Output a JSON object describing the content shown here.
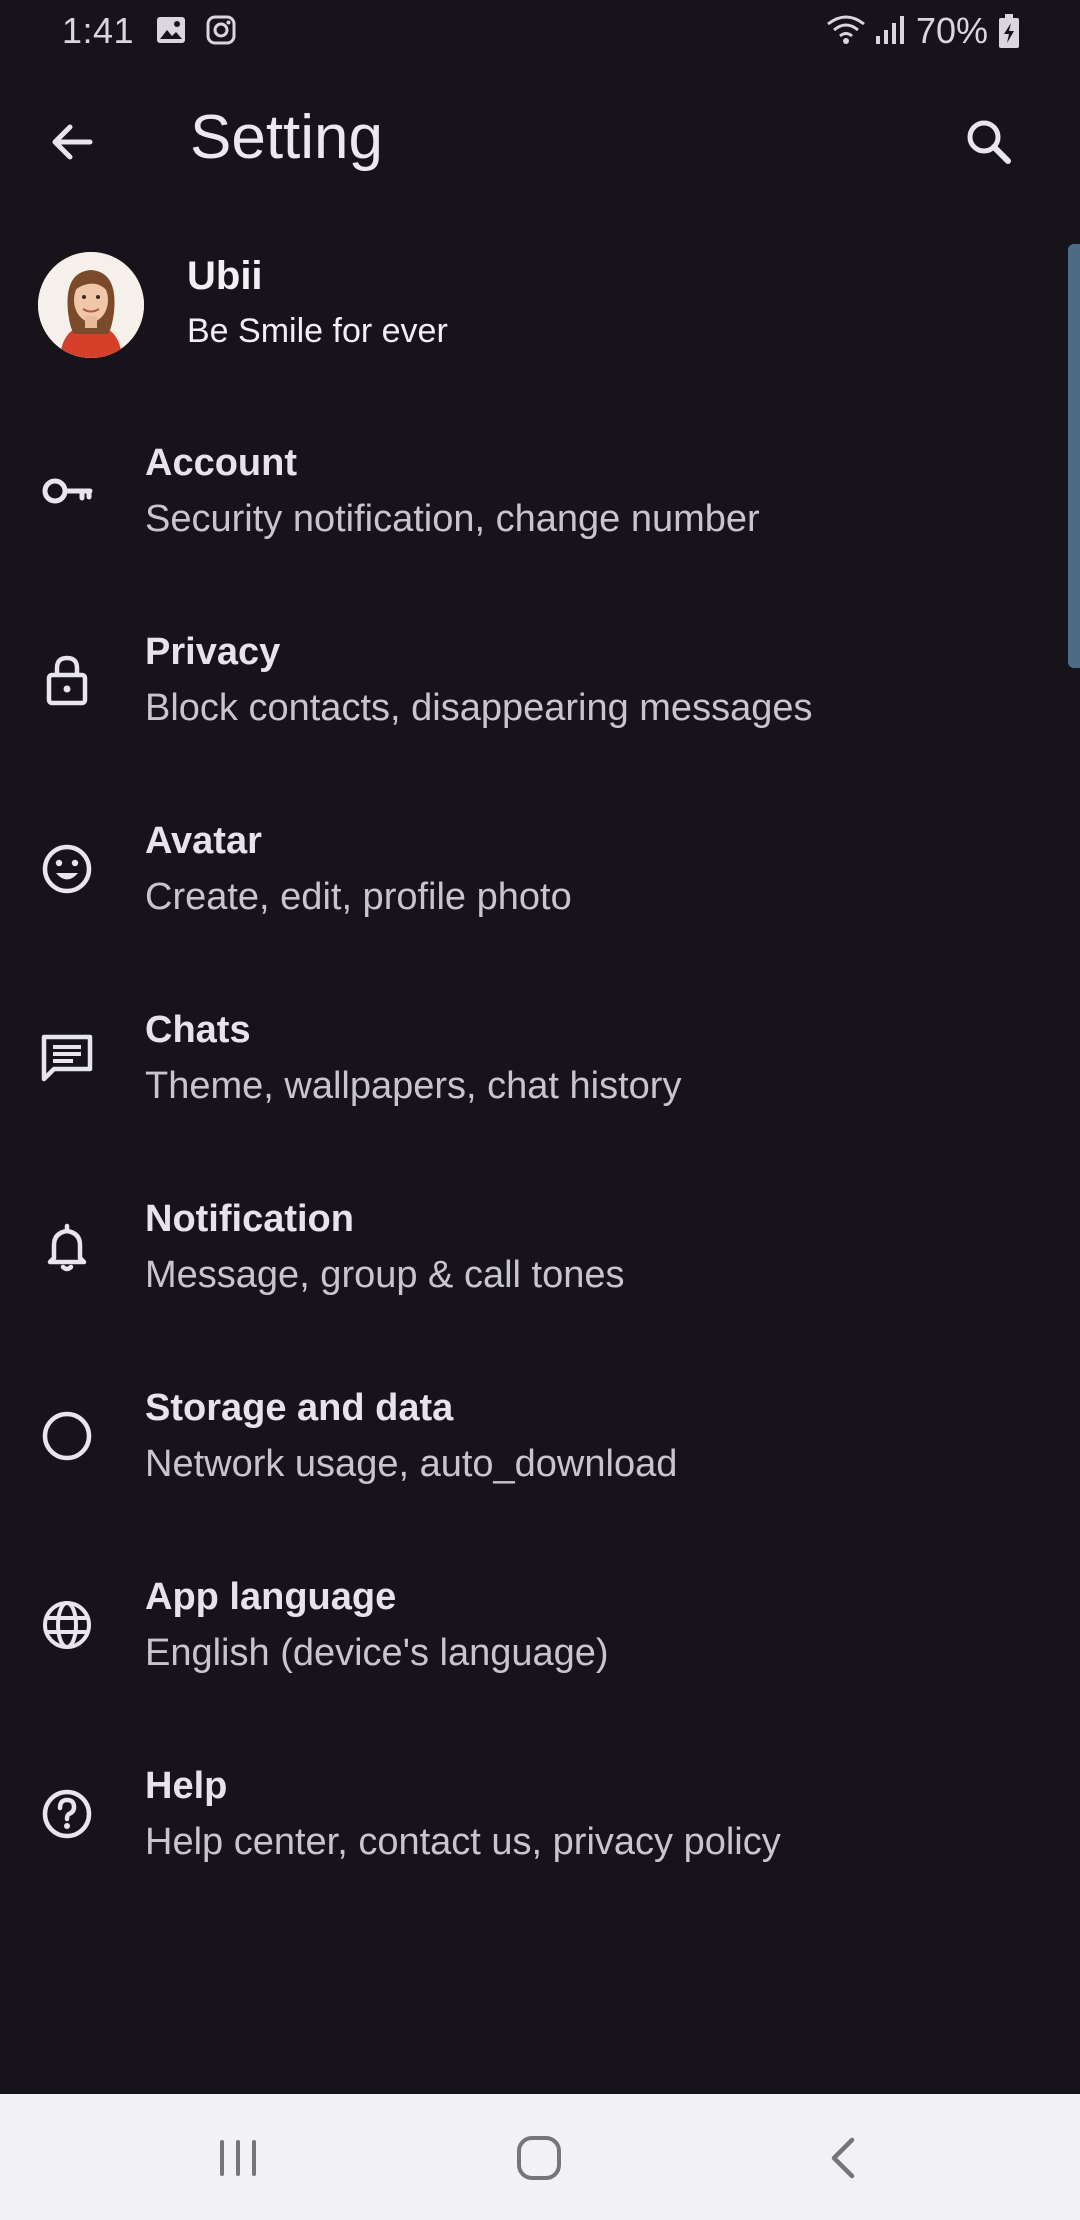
{
  "status_bar": {
    "time": "1:41",
    "battery": "70%"
  },
  "header": {
    "title": "Setting",
    "back_icon": "arrow-left-icon",
    "search_icon": "search-icon"
  },
  "profile": {
    "name": "Ubii",
    "status": "Be Smile for ever"
  },
  "settings": [
    {
      "icon": "key-icon",
      "title": "Account",
      "subtitle": "Security notification, change number"
    },
    {
      "icon": "lock-icon",
      "title": "Privacy",
      "subtitle": "Block contacts, disappearing messages"
    },
    {
      "icon": "smiley-icon",
      "title": "Avatar",
      "subtitle": "Create, edit, profile photo"
    },
    {
      "icon": "chat-icon",
      "title": "Chats",
      "subtitle": "Theme, wallpapers, chat history"
    },
    {
      "icon": "bell-icon",
      "title": "Notification",
      "subtitle": "Message, group & call tones"
    },
    {
      "icon": "circle-icon",
      "title": "Storage and data",
      "subtitle": "Network usage, auto_download"
    },
    {
      "icon": "globe-icon",
      "title": "App language",
      "subtitle": "English (device's language)"
    },
    {
      "icon": "help-icon",
      "title": "Help",
      "subtitle": "Help center, contact us, privacy policy"
    }
  ],
  "colors": {
    "background": "#16131b",
    "text_primary": "#e6e3ea",
    "text_secondary": "#c9c5cf",
    "nav_bar": "#f2f1f3",
    "scrollbar": "#4e6b86"
  }
}
